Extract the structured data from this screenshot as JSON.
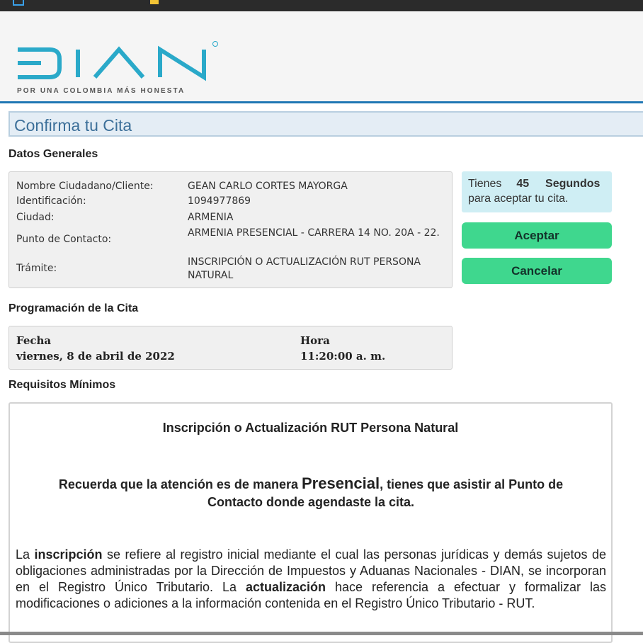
{
  "brand": {
    "name": "DIAN",
    "tagline": "POR UNA COLOMBIA MÁS HONESTA",
    "color": "#2aa9c9"
  },
  "page_title": "Confirma tu Cita",
  "datos_generales": {
    "heading": "Datos Generales",
    "rows": [
      {
        "label": "Nombre Ciudadano/Cliente:",
        "value": "GEAN CARLO CORTES MAYORGA"
      },
      {
        "label": "Identificación:",
        "value": "1094977869"
      },
      {
        "label": "Ciudad:",
        "value": "ARMENIA"
      },
      {
        "label": "Punto de Contacto:",
        "value": "ARMENIA PRESENCIAL - CARRERA 14 NO. 20A - 22."
      },
      {
        "label": "Trámite:",
        "value": "INSCRIPCIÓN O ACTUALIZACIÓN RUT PERSONA NATURAL"
      }
    ]
  },
  "timer": {
    "prefix": "Tienes",
    "seconds": "45",
    "unit": "Segundos",
    "suffix": "para aceptar tu cita."
  },
  "buttons": {
    "accept": "Aceptar",
    "cancel": "Cancelar"
  },
  "programacion": {
    "heading": "Programación de la Cita",
    "fecha_label": "Fecha",
    "fecha_value": "viernes, 8 de abril de 2022",
    "hora_label": "Hora",
    "hora_value": "11:20:00 a. m."
  },
  "requisitos": {
    "heading": "Requisitos Mínimos",
    "title": "Inscripción o Actualización RUT Persona Natural",
    "note_part1": "Recuerda que la atención es de manera ",
    "note_emphasis": "Presencial",
    "note_part2": ", tienes que asistir al Punto de Contacto donde agendaste la cita.",
    "body_part1": "La ",
    "body_bold1": "inscripción",
    "body_part2": " se refiere al registro inicial mediante el cual las personas jurídicas y demás sujetos de obligaciones administradas por la Dirección de Impuestos y Aduanas Nacionales - DIAN, se incorporan en el Registro Único Tributario. La ",
    "body_bold2": "actualización",
    "body_part3": " hace referencia a efectuar y formalizar las modificaciones o adiciones a la información contenida en el Registro Único Tributario - RUT."
  }
}
